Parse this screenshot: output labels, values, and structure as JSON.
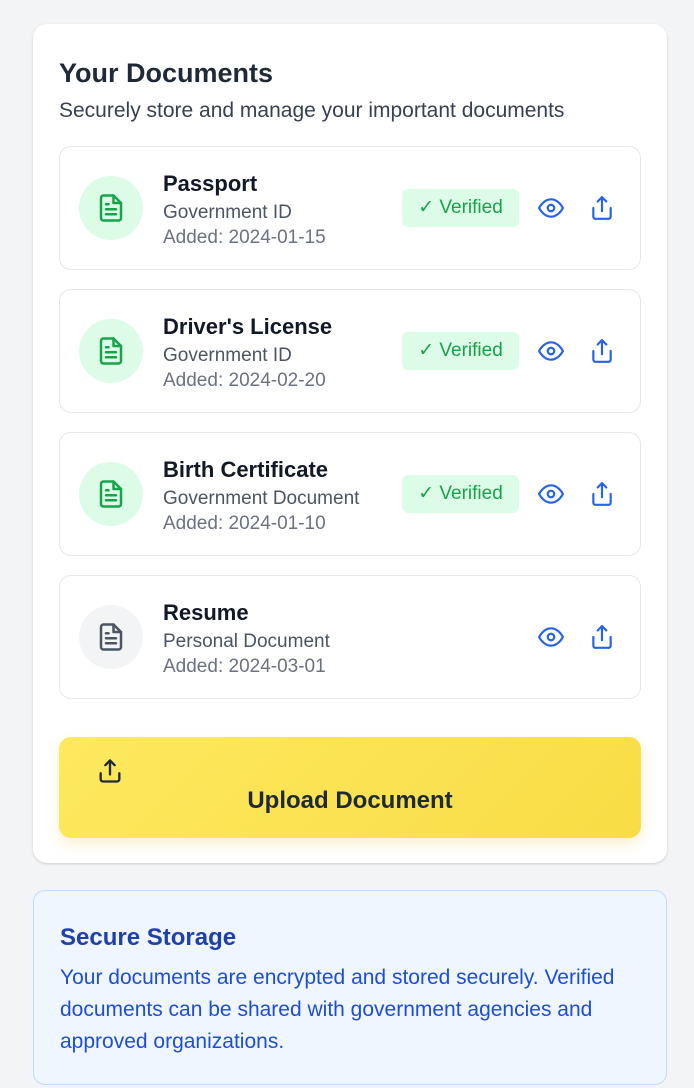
{
  "documents_section": {
    "title": "Your Documents",
    "subtitle": "Securely store and manage your important documents"
  },
  "documents": [
    {
      "name": "Passport",
      "type": "Government ID",
      "added": "Added: 2024-01-15",
      "verified": true,
      "badge": "✓ Verified"
    },
    {
      "name": "Driver's License",
      "type": "Government ID",
      "added": "Added: 2024-02-20",
      "verified": true,
      "badge": "✓ Verified"
    },
    {
      "name": "Birth Certificate",
      "type": "Government Document",
      "added": "Added: 2024-01-10",
      "verified": true,
      "badge": "✓ Verified"
    },
    {
      "name": "Resume",
      "type": "Personal Document",
      "added": "Added: 2024-03-01",
      "verified": false,
      "badge": ""
    }
  ],
  "upload": {
    "label": "Upload Document",
    "icon": "upload-icon"
  },
  "info": {
    "title": "Secure Storage",
    "text": "Your documents are encrypted and stored securely. Verified documents can be shared with government agencies and approved organizations."
  },
  "icons": {
    "document": "file-text-icon",
    "view": "eye-icon",
    "share": "share-icon"
  },
  "colors": {
    "verified_green": "#16a34a",
    "verified_bg": "#dcfce7",
    "action_blue": "#2563eb",
    "upload_yellow": "#fde047",
    "info_blue": "#1e40af"
  }
}
